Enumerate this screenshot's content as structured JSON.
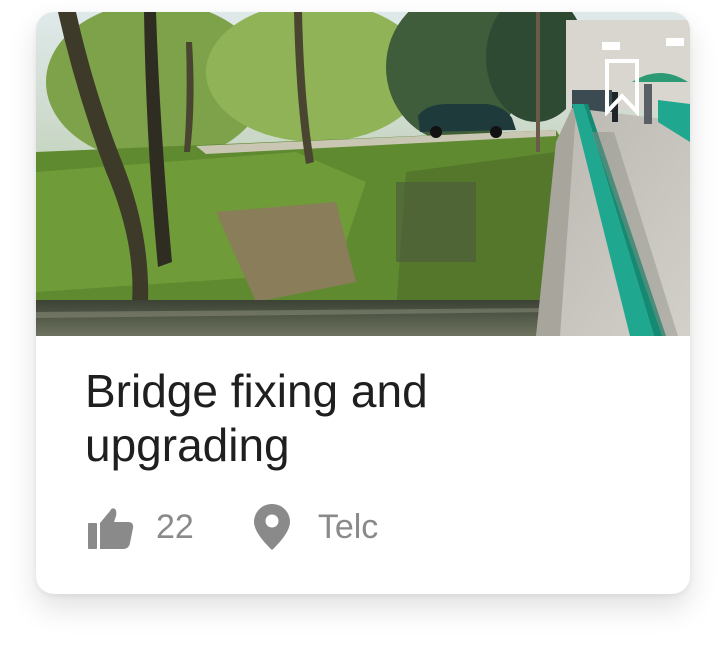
{
  "card": {
    "title": "Bridge fixing and upgrading",
    "likes": "22",
    "location": "Telc"
  },
  "icons": {
    "bookmark": "bookmark-icon",
    "likes": "thumbs-up-icon",
    "location": "map-pin-icon"
  },
  "colors": {
    "title_text": "#1f1f1f",
    "meta_text": "#8a8a8a",
    "railing": "#1fa88f"
  }
}
